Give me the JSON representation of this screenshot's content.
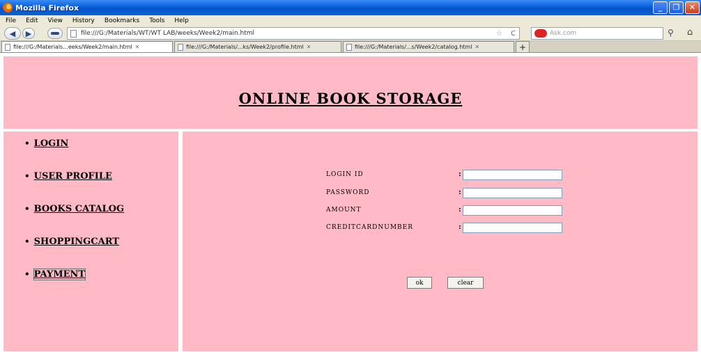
{
  "window": {
    "title": "Mozilla Firefox",
    "minimize": "_",
    "maximize": "❐",
    "close": "✕"
  },
  "menu": [
    "File",
    "Edit",
    "View",
    "History",
    "Bookmarks",
    "Tools",
    "Help"
  ],
  "nav": {
    "back": "◀",
    "forward": "▶",
    "url": "file:///G:/Materials/WT/WT LAB/weeks/Week2/main.html",
    "search_placeholder": "Ask.com",
    "reload": "C",
    "star": "☆",
    "home": "⌂",
    "search_go": "⚲"
  },
  "tabs": [
    {
      "label": "file:///G:/Materials...eeks/Week2/main.html",
      "close": "✕"
    },
    {
      "label": "file:///G:/Materials/...ks/Week2/profile.html",
      "close": "✕"
    },
    {
      "label": "file:///G:/Materials/...s/Week2/catalog.html",
      "close": "✕"
    }
  ],
  "new_tab": "+",
  "page": {
    "heading": "ONLINE BOOK STORAGE",
    "sidebar": [
      {
        "bullet": "•",
        "label": "LOGIN"
      },
      {
        "bullet": "•",
        "label": "USER PROFILE"
      },
      {
        "bullet": "•",
        "label": "BOOKS CATALOG"
      },
      {
        "bullet": "•",
        "label": "SHOPPINGCART"
      },
      {
        "bullet": "•",
        "label": "PAYMENT"
      }
    ],
    "form": {
      "fields": [
        {
          "label": "LOGIN ID",
          "colon": ":",
          "value": ""
        },
        {
          "label": "PASSWORD",
          "colon": ":",
          "value": ""
        },
        {
          "label": "AMOUNT",
          "colon": ":",
          "value": ""
        },
        {
          "label": "CREDITCARDNUMBER",
          "colon": ":",
          "value": ""
        }
      ],
      "ok_label": "ok",
      "clear_label": "clear"
    }
  }
}
